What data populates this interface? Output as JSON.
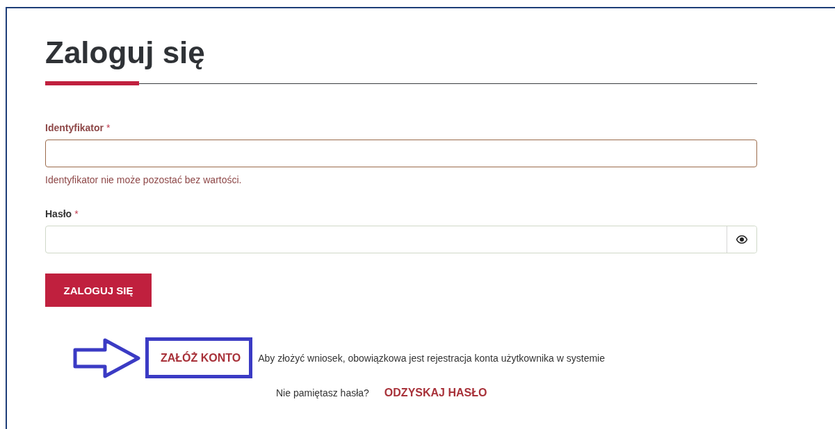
{
  "title": "Zaloguj się",
  "fields": [
    {
      "label": "Identyfikator",
      "required": true,
      "error": true,
      "error_text": "Identyfikator nie może pozostać bez wartości.",
      "kind": "text"
    },
    {
      "label": "Hasło",
      "required": true,
      "error": false,
      "kind": "password"
    }
  ],
  "required_mark": "*",
  "submit_button": "ZALOGUJ SIĘ",
  "register": {
    "link": "ZAŁÓŻ KONTO",
    "highlighted": true,
    "note": "Aby złożyć wniosek, obowiązkowa jest rejestracja konta użytkownika w systemie"
  },
  "recover": {
    "question": "Nie pamiętasz hasła?",
    "link": "ODZYSKAJ HASŁO"
  }
}
